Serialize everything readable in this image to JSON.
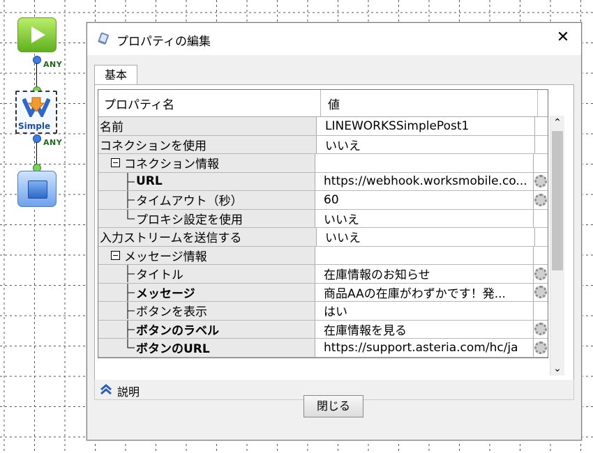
{
  "canvas": {
    "simple_label": "Simple",
    "connector_label_1": "ANY",
    "connector_label_2": "ANY"
  },
  "dialog": {
    "title": "プロパティの編集",
    "tab": "基本",
    "columns": [
      "プロパティ名",
      "値"
    ],
    "rows": [
      {
        "name": "名前",
        "value": "LINEWORKSSimplePost1",
        "level": 0,
        "bold": false,
        "gear": false
      },
      {
        "name": "コネクションを使用",
        "value": "いいえ",
        "level": 0,
        "bold": false,
        "gear": false
      },
      {
        "name": "コネクション情報",
        "value": "",
        "level": 1,
        "bold": false,
        "gear": false,
        "group": true
      },
      {
        "name": "URL",
        "value": "https://webhook.worksmobile.co...",
        "level": 2,
        "bold": true,
        "gear": true
      },
      {
        "name": "タイムアウト（秒）",
        "value": "60",
        "level": 2,
        "bold": false,
        "gear": true
      },
      {
        "name": "プロキシ設定を使用",
        "value": "いいえ",
        "level": 2,
        "bold": false,
        "gear": false,
        "last": true
      },
      {
        "name": "入力ストリームを送信する",
        "value": "いいえ",
        "level": 0,
        "bold": false,
        "gear": false
      },
      {
        "name": "メッセージ情報",
        "value": "",
        "level": 1,
        "bold": false,
        "gear": false,
        "group": true
      },
      {
        "name": "タイトル",
        "value": "在庫情報のお知らせ",
        "level": 2,
        "bold": false,
        "gear": true
      },
      {
        "name": "メッセージ",
        "value": "商品AAの在庫がわずかです！発...",
        "level": 2,
        "bold": true,
        "gear": true
      },
      {
        "name": "ボタンを表示",
        "value": "はい",
        "level": 2,
        "bold": false,
        "gear": false
      },
      {
        "name": "ボタンのラベル",
        "value": "在庫情報を見る",
        "level": 2,
        "bold": true,
        "gear": true
      },
      {
        "name": "ボタンのURL",
        "value": "https://support.asteria.com/hc/ja",
        "level": 2,
        "bold": true,
        "gear": true,
        "last": true
      }
    ],
    "description_label": "説明",
    "close_button": "閉じる"
  },
  "colors": {
    "start_green": "#5fb01f",
    "end_blue": "#2d69c9",
    "any_label": "#1c6a1c"
  }
}
